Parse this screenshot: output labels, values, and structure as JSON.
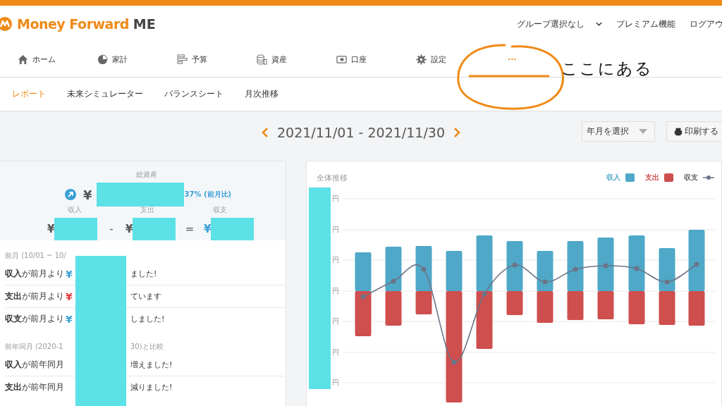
{
  "header": {
    "logo_brand": "Money Forward",
    "logo_suffix": "ME",
    "links": [
      {
        "label": "グループ選択なし",
        "kind": "dropdown"
      },
      {
        "label": "プレミアム機能",
        "kind": "link"
      },
      {
        "label": "ログアウ",
        "kind": "link"
      }
    ]
  },
  "nav": [
    {
      "label": "ホーム",
      "selected": false
    },
    {
      "label": "家計",
      "selected": false
    },
    {
      "label": "予算",
      "selected": false
    },
    {
      "label": "資産",
      "selected": false
    },
    {
      "label": "口座",
      "selected": false
    },
    {
      "label": "設定",
      "selected": false
    },
    {
      "label": "···",
      "selected": true
    }
  ],
  "subnav": [
    {
      "label": "レポート",
      "selected": true
    },
    {
      "label": "未来シミュレーター",
      "selected": false
    },
    {
      "label": "バランスシート",
      "selected": false
    },
    {
      "label": "月次推移",
      "selected": false
    }
  ],
  "period": {
    "range": "2021/11/01 - 2021/11/30"
  },
  "controls": {
    "month_select": "年月を選択",
    "print_button": "印刷する"
  },
  "summary": {
    "title": "総資産",
    "total_yen": "¥",
    "change": "37% (前月比)",
    "columns": [
      {
        "label": "収入",
        "yen": "¥"
      },
      {
        "label": "支出",
        "yen": "¥"
      },
      {
        "label": "収支",
        "yen": "¥"
      }
    ],
    "operators": [
      "-",
      "="
    ]
  },
  "comparisons": [
    {
      "heading_start": "前月 (10/01 ~ 10/",
      "rows": [
        {
          "label": "**収入**が前月より",
          "yen": "¥",
          "color": "#3aa0d0",
          "tail": "ました!"
        },
        {
          "label": "**支出**が前月より",
          "yen": "¥",
          "color": "#e0393e",
          "tail": "ています"
        },
        {
          "label": "**収支**が前月より",
          "yen": "¥",
          "color": "#3aa0d0",
          "tail": "しました!"
        }
      ]
    },
    {
      "heading_start": "前年同月 (2020-1",
      "heading_end": "30)と比較",
      "rows": [
        {
          "label": "**収入**が前年同月",
          "tail": "増えました!"
        },
        {
          "label": "**支出**が前年同月",
          "tail": "減りました!"
        }
      ]
    }
  ],
  "chart": {
    "title": "全体推移",
    "legend": [
      {
        "label": "収入",
        "color": "#4fa8c8",
        "kind": "bar"
      },
      {
        "label": "支出",
        "color": "#cf4e4e",
        "kind": "bar"
      },
      {
        "label": "収支",
        "color": "#6b7487",
        "kind": "line"
      }
    ],
    "axis_labels": [
      "円",
      "円",
      "円",
      "円",
      "円",
      "円",
      "円"
    ]
  },
  "annotation": {
    "text": "ここにある"
  }
}
